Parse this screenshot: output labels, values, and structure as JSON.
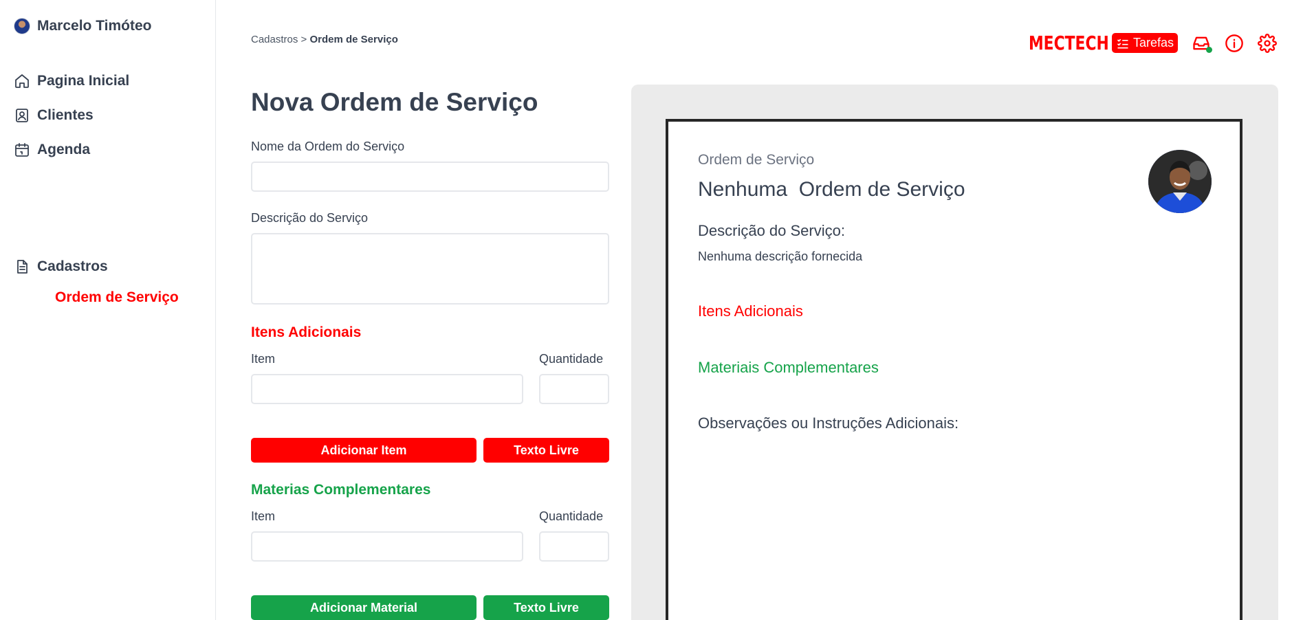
{
  "sidebar": {
    "user_name": "Marcelo Timóteo",
    "nav": [
      {
        "label": "Pagina Inicial",
        "icon": "home-icon"
      },
      {
        "label": "Clientes",
        "icon": "contact-icon"
      },
      {
        "label": "Agenda",
        "icon": "calendar-icon"
      },
      {
        "label": "Cadastros",
        "icon": "document-icon"
      }
    ],
    "sub_item": "Ordem de Serviço"
  },
  "header": {
    "breadcrumb_parent": "Cadastros",
    "breadcrumb_sep": ">",
    "breadcrumb_current": "Ordem de Serviço",
    "brand": "MECTECH",
    "tasks_label": "Tarefas",
    "accent_color": "#ff0000",
    "success_color": "#16a34a"
  },
  "form": {
    "title": "Nova Ordem de Serviço",
    "name_label": "Nome da Ordem do Serviço",
    "name_value": "",
    "desc_label": "Descrição do Serviço",
    "desc_value": "",
    "items_section": "Itens Adicionais",
    "items_item_label": "Item",
    "items_qty_label": "Quantidade",
    "add_item_button": "Adicionar Item",
    "free_text_button": "Texto Livre",
    "materials_section": "Materias Complementares",
    "materials_item_label": "Item",
    "materials_qty_label": "Quantidade",
    "add_material_button": "Adicionar Material",
    "materials_free_text_button": "Texto Livre"
  },
  "preview": {
    "subtitle": "Ordem de Serviço",
    "title": "Nenhuma  Ordem de Serviço",
    "desc_label": "Descrição do Serviço:",
    "desc_text": "Nenhuma descrição fornecida",
    "items_section": "Itens Adicionais",
    "materials_section": "Materiais Complementares",
    "notes_label": "Observações ou Instruções Adicionais:"
  }
}
